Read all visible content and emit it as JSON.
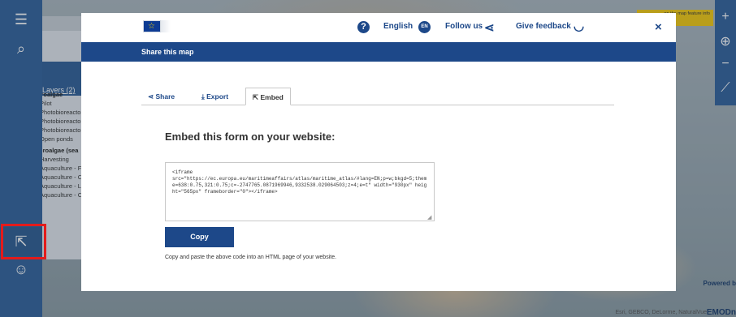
{
  "map": {
    "attribution": "Esri, GEBCO, DeLorme, NaturalVue",
    "brand": "EMODn",
    "powered": "Powered b",
    "tooltip": "on the map feature info"
  },
  "layers_panel": {
    "tab_label": "Layers (2)",
    "groups": [
      {
        "heading": "Microalgae",
        "items": [
          "Pilot",
          "Photobioreacto",
          "Photobioreacto",
          "Photobioreacto",
          "Open ponds"
        ]
      },
      {
        "heading": "Macroalgae (sea",
        "items": [
          "Harvesting",
          "Aquaculture - F",
          "Aquaculture - C",
          "Aquaculture - L",
          "Aquaculture - C"
        ]
      }
    ]
  },
  "topbar": {
    "language": "English",
    "language_code": "EN",
    "follow": "Follow us",
    "feedback": "Give feedback",
    "close": "×"
  },
  "modal": {
    "title": "Share this map",
    "tabs": [
      {
        "label": "Share",
        "icon": "share-icon",
        "active": false
      },
      {
        "label": "Export",
        "icon": "download-icon",
        "active": false
      },
      {
        "label": "Embed",
        "icon": "embed-icon",
        "active": true
      }
    ],
    "embed_heading": "Embed this form on your website:",
    "code": "<iframe\nsrc=\"https://ec.europa.eu/maritimeaffairs/atlas/maritime_atlas/#lang=EN;p=w;bkgd=5;theme=638:0.75,321:0.75;c=-2747765.0871969946,9332538.029064503;z=4;e=t\" width=\"930px\" height=\"565px\" frameborder=\"0\"></iframe>",
    "copy_button": "Copy",
    "hint": "Copy and paste the above code into an HTML page of your website."
  },
  "colors": {
    "primary": "#1d4889",
    "highlight": "#e31b1b",
    "tooltip": "#f2c80f"
  }
}
